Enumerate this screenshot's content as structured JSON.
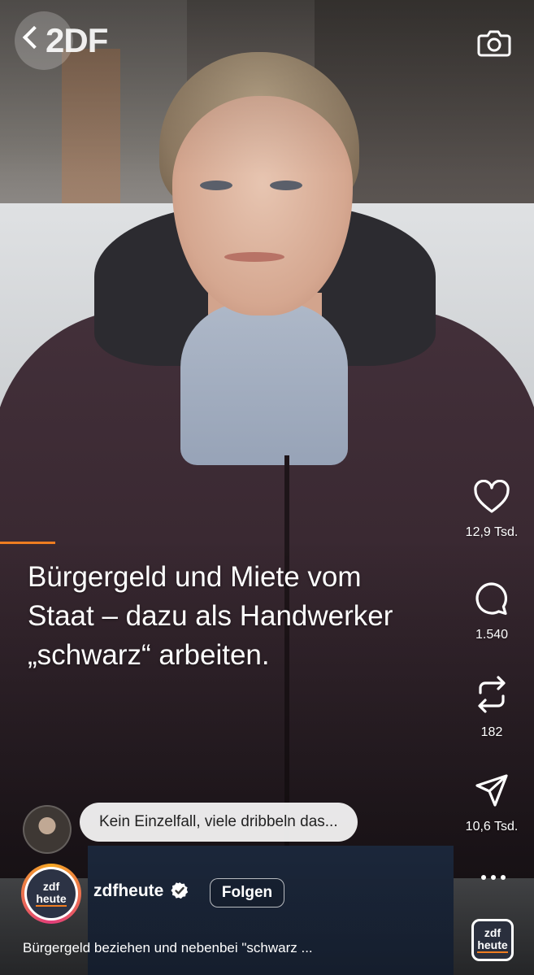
{
  "top_bar": {
    "brand_text": "2DF"
  },
  "headline": {
    "line1": "Bürgergeld und Miete vom",
    "line2": "Staat – dazu als Handwerker",
    "line3": "„schwarz“ arbeiten."
  },
  "actions": {
    "likes": "12,9 Tsd.",
    "comments": "1.540",
    "reposts": "182",
    "shares": "10,6 Tsd."
  },
  "comment_preview": {
    "text": "Kein Einzelfall, viele dribbeln das..."
  },
  "account": {
    "name": "zdfheute",
    "follow_label": "Folgen",
    "logo_top": "zdf",
    "logo_bottom": "heute"
  },
  "description": "Bürgergeld beziehen und nebenbei \"schwarz ...",
  "colors": {
    "accent": "#ef7d21",
    "overlay_text": "#ffffff"
  }
}
